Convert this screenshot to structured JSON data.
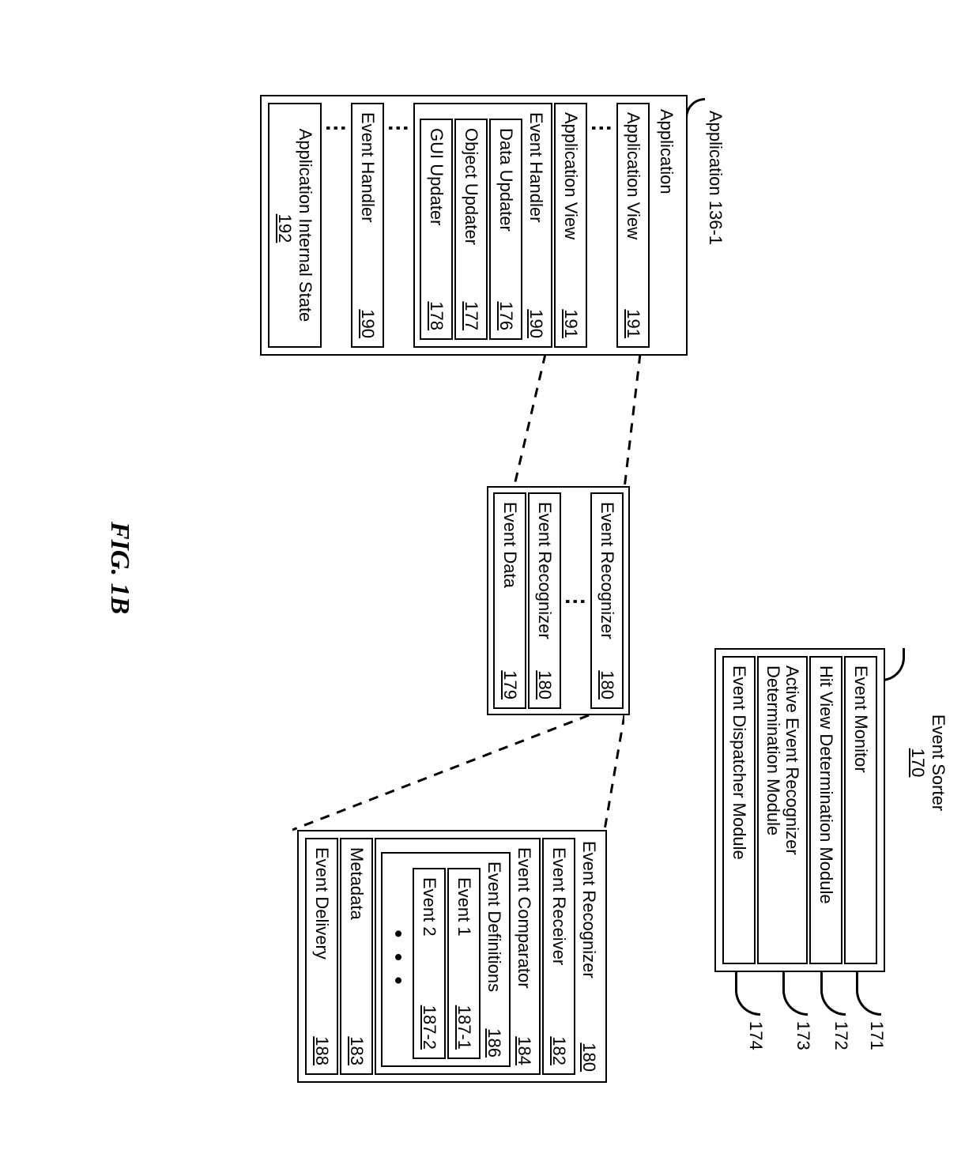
{
  "fig": "FIG. 1B",
  "eventSorter": {
    "title": "Event Sorter",
    "titleRef": "170",
    "items": [
      {
        "label": "Event Monitor",
        "ref": "171"
      },
      {
        "label": "Hit View Determination Module",
        "ref": "172"
      },
      {
        "label": "Active Event Recognizer Determination Module",
        "ref": "173"
      },
      {
        "label": "Event Dispatcher Module",
        "ref": "174"
      }
    ]
  },
  "application": {
    "titlePrefix": "Application",
    "titleRef": "136-1",
    "header": "Application",
    "appView": {
      "label": "Application View",
      "ref": "191"
    },
    "eventHandler": {
      "label": "Event Handler",
      "ref": "190",
      "children": [
        {
          "label": "Data Updater",
          "ref": "176"
        },
        {
          "label": "Object Updater",
          "ref": "177"
        },
        {
          "label": "GUI Updater",
          "ref": "178"
        }
      ]
    },
    "internalState": {
      "label": "Application Internal State",
      "ref": "192"
    }
  },
  "middle": {
    "recognizer": {
      "label": "Event Recognizer",
      "ref": "180"
    },
    "eventData": {
      "label": "Event Data",
      "ref": "179"
    }
  },
  "recognizerDetail": {
    "title": {
      "label": "Event Recognizer",
      "ref": "180"
    },
    "receiver": {
      "label": "Event Receiver",
      "ref": "182"
    },
    "comparator": {
      "label": "Event Comparator",
      "ref": "184",
      "defs": {
        "label": "Event Definitions",
        "ref": "186",
        "events": [
          {
            "label": "Event 1",
            "ref": "187-1"
          },
          {
            "label": "Event 2",
            "ref": "187-2"
          }
        ]
      }
    },
    "metadata": {
      "label": "Metadata",
      "ref": "183"
    },
    "delivery": {
      "label": "Event Delivery",
      "ref": "188"
    }
  }
}
